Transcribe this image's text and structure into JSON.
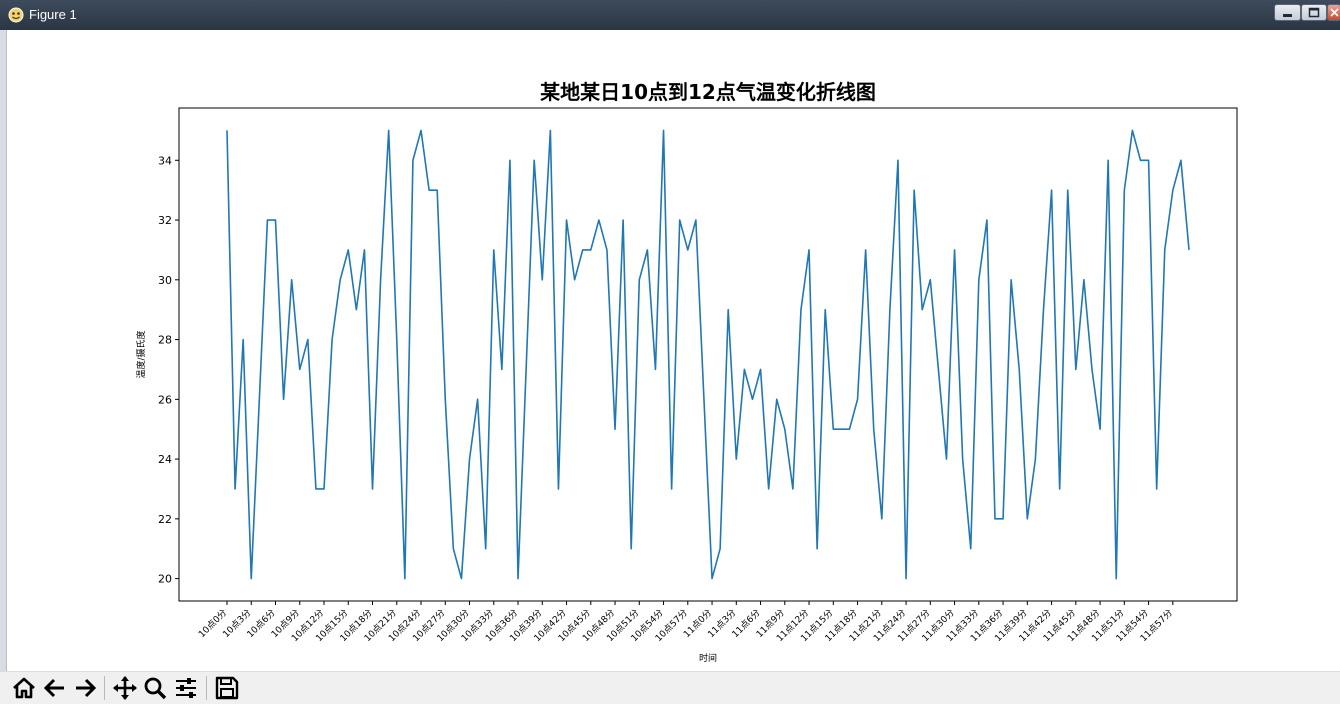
{
  "window": {
    "title": "Figure 1"
  },
  "colors": {
    "line": "#1f77b4",
    "axes": "#000000",
    "titlebar": "#2b3644"
  },
  "toolbar": {
    "items": [
      {
        "name": "home-button",
        "icon": "home-icon"
      },
      {
        "name": "back-button",
        "icon": "arrow-left-icon"
      },
      {
        "name": "forward-button",
        "icon": "arrow-right-icon"
      },
      {
        "name": "pan-button",
        "icon": "move-icon"
      },
      {
        "name": "zoom-button",
        "icon": "zoom-icon"
      },
      {
        "name": "configure-subplots-button",
        "icon": "sliders-icon"
      },
      {
        "name": "save-button",
        "icon": "save-icon"
      }
    ]
  },
  "chart_data": {
    "type": "line",
    "title": "某地某日10点到12点气温变化折线图",
    "xlabel": "时间",
    "ylabel": "温度/摄氏度",
    "ylim": [
      19.25,
      35.75
    ],
    "yticks": [
      20,
      22,
      24,
      26,
      28,
      30,
      32,
      34
    ],
    "xtick_step": 3,
    "xtick_labels": [
      "10点0分",
      "10点3分",
      "10点6分",
      "10点9分",
      "10点12分",
      "10点15分",
      "10点18分",
      "10点21分",
      "10点24分",
      "10点27分",
      "10点30分",
      "10点33分",
      "10点36分",
      "10点39分",
      "10点42分",
      "10点45分",
      "10点48分",
      "10点51分",
      "10点54分",
      "10点57分",
      "11点0分",
      "11点3分",
      "11点6分",
      "11点9分",
      "11点12分",
      "11点15分",
      "11点18分",
      "11点21分",
      "11点24分",
      "11点27分",
      "11点30分",
      "11点33分",
      "11点36分",
      "11点39分",
      "11点42分",
      "11点45分",
      "11点48分",
      "11点51分",
      "11点54分",
      "11点57分"
    ],
    "grid": false,
    "series": [
      {
        "values": [
          35,
          23,
          28,
          20,
          26,
          32,
          32,
          26,
          30,
          27,
          28,
          23,
          23,
          28,
          30,
          31,
          29,
          31,
          23,
          30,
          35,
          28,
          20,
          34,
          35,
          33,
          33,
          26,
          21,
          20,
          24,
          26,
          21,
          31,
          27,
          34,
          20,
          27,
          34,
          30,
          35,
          23,
          32,
          30,
          31,
          31,
          32,
          31,
          25,
          32,
          21,
          30,
          31,
          27,
          35,
          23,
          32,
          31,
          32,
          26,
          20,
          21,
          29,
          24,
          27,
          26,
          27,
          23,
          26,
          25,
          23,
          29,
          31,
          21,
          29,
          25,
          25,
          25,
          26,
          31,
          25,
          22,
          29,
          34,
          20,
          33,
          29,
          30,
          27,
          24,
          31,
          24,
          21,
          30,
          32,
          22,
          22,
          30,
          27,
          22,
          24,
          29,
          33,
          23,
          33,
          27,
          30,
          27,
          25,
          34,
          20,
          33,
          35,
          34,
          34,
          23,
          31,
          33,
          34,
          31
        ]
      }
    ]
  }
}
